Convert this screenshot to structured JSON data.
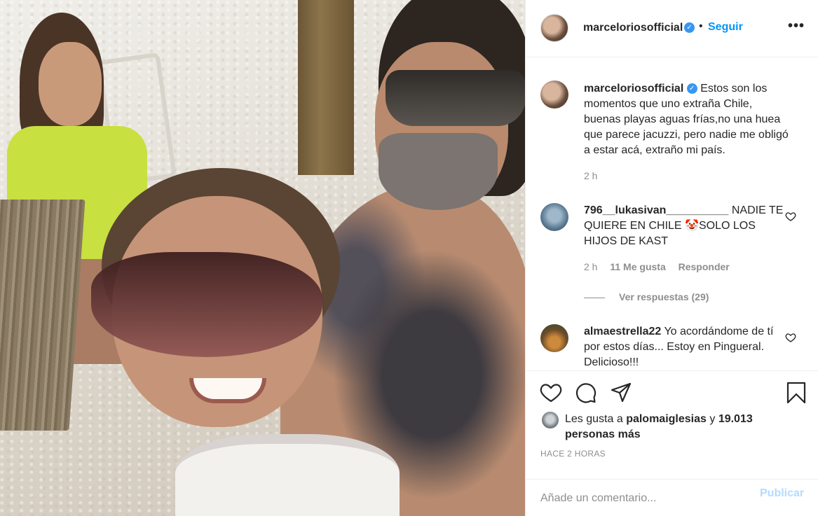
{
  "post": {
    "username": "marceloriosofficial",
    "verified_icon": "verified-badge-icon",
    "dot": "•",
    "follow_label": "Seguir",
    "more_label": "•••"
  },
  "caption": {
    "username": "marceloriosofficial",
    "text": "Estos son los momentos que uno extraña Chile, buenas playas aguas frías,no una huea que parece jacuzzi, pero nadie me obligó a estar acá, extraño mi país.",
    "time": "2 h"
  },
  "comments": [
    {
      "username": "796__lukasivan__________",
      "text": "NADIE TE QUIERE EN CHILE 🤡SOLO LOS HIJOS DE KAST",
      "time": "2 h",
      "likes": "11 Me gusta",
      "reply_label": "Responder",
      "view_replies": "Ver respuestas (29)"
    },
    {
      "username": "almaestrella22",
      "text": "Yo acordándome de tí por estos días... Estoy en Pingueral. Delicioso!!!"
    }
  ],
  "likes": {
    "prefix": "Les gusta a",
    "user": "palomaiglesias",
    "conj": "y",
    "count": "19.013 personas más"
  },
  "timestamp": "HACE 2 HORAS",
  "add_comment": {
    "placeholder": "Añade un comentario...",
    "publish_label": "Publicar"
  },
  "colors": {
    "accent": "#0095f6",
    "publish_disabled": "#b3dbff",
    "verified": "#3897f0",
    "muted": "#8e8e8e"
  }
}
